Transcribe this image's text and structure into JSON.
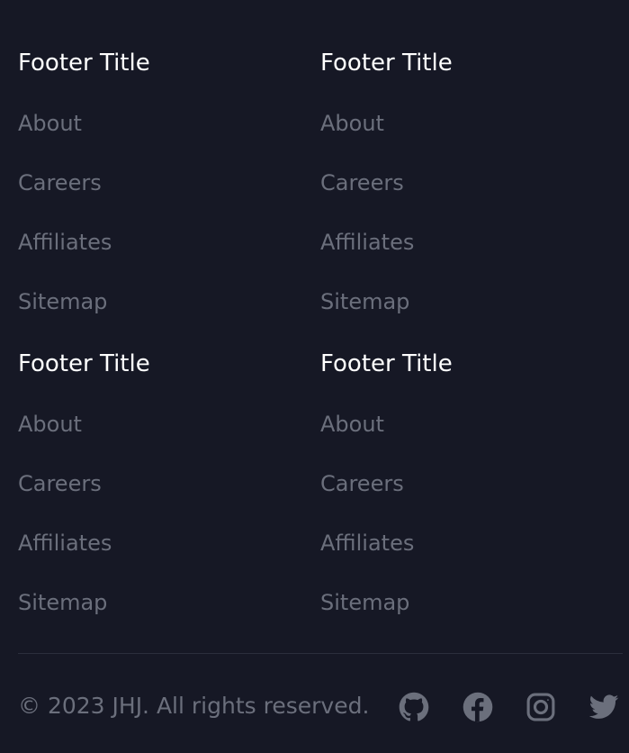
{
  "footer": {
    "columns": [
      {
        "title": "Footer Title",
        "links": [
          "About",
          "Careers",
          "Affiliates",
          "Sitemap"
        ]
      },
      {
        "title": "Footer Title",
        "links": [
          "About",
          "Careers",
          "Affiliates",
          "Sitemap"
        ]
      },
      {
        "title": "Footer Title",
        "links": [
          "About",
          "Careers",
          "Affiliates",
          "Sitemap"
        ]
      },
      {
        "title": "Footer Title",
        "links": [
          "About",
          "Careers",
          "Affiliates",
          "Sitemap"
        ]
      }
    ],
    "copyright": "© 2023 JHJ. All rights reserved.",
    "social": [
      "github-icon",
      "facebook-icon",
      "instagram-icon",
      "twitter-icon"
    ]
  },
  "colors": {
    "background": "#161825",
    "title": "#ffffff",
    "link": "#6b6f7c",
    "divider": "#2b2e3c"
  }
}
